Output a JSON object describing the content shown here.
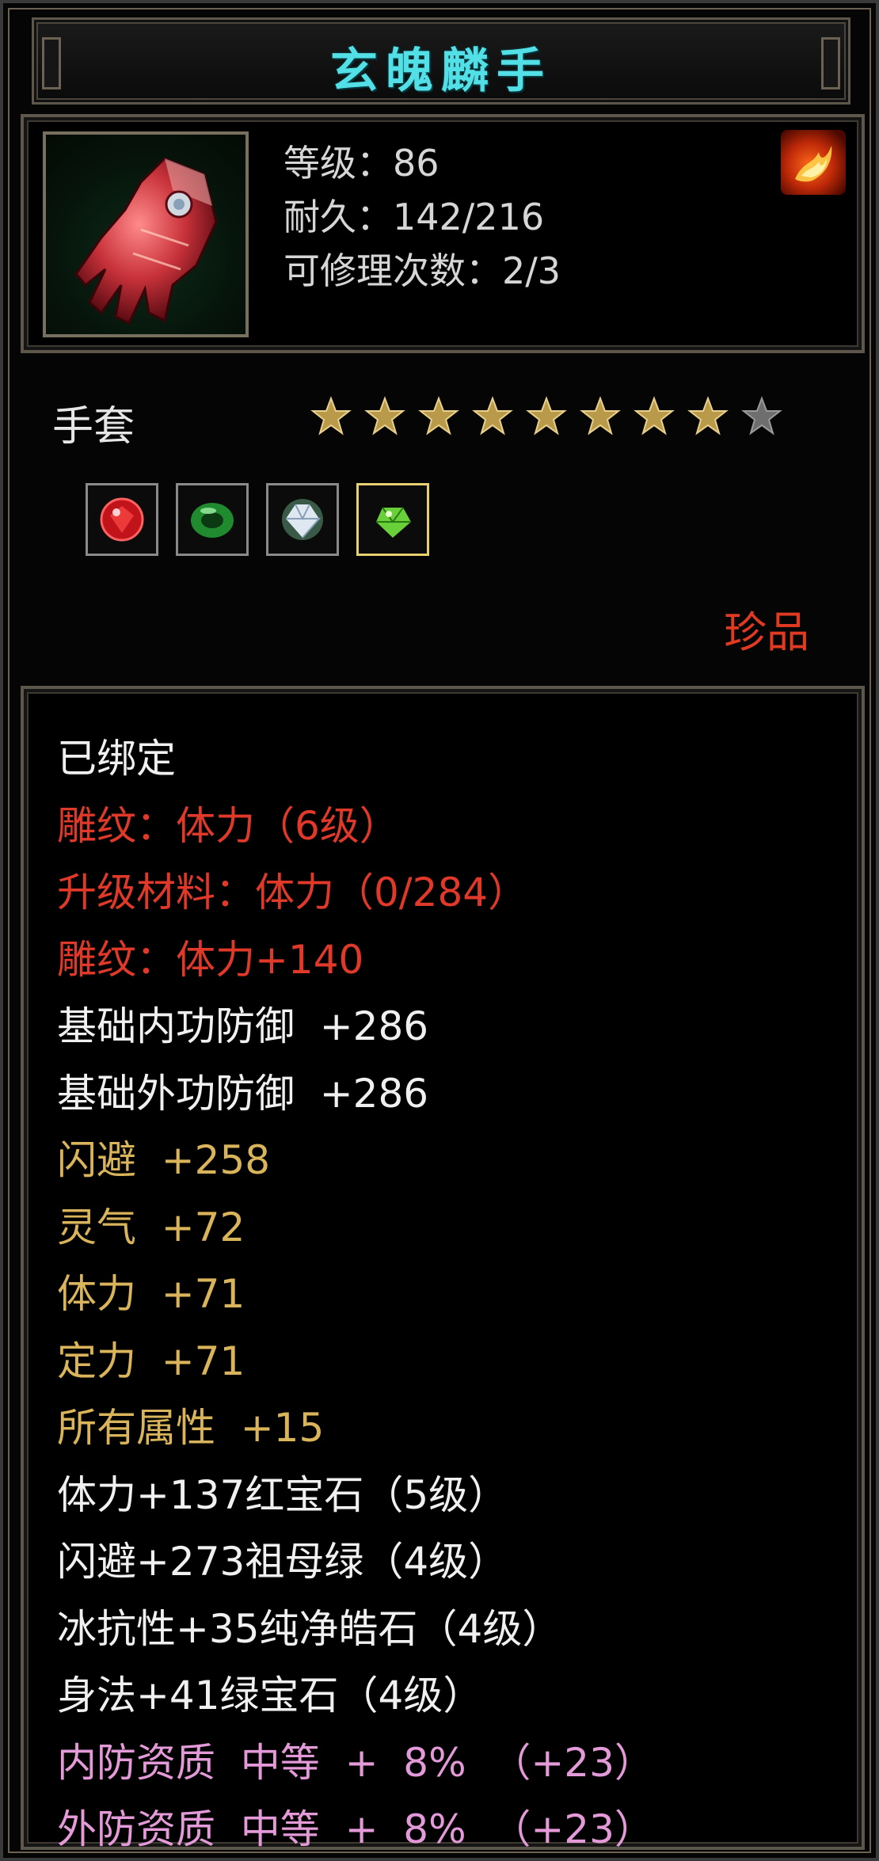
{
  "title": "玄魄麟手",
  "item": {
    "level": "等级：86",
    "durability": "耐久：142/216",
    "repair": "可修理次数：2/3",
    "icon": "gauntlet-icon",
    "badge_icon": "fire-badge-icon"
  },
  "type_label": "手套",
  "stars": {
    "filled": 8,
    "total": 9
  },
  "gems": [
    "ruby-gem-icon",
    "emerald-gem-icon",
    "diamond-gem-icon",
    "peridot-gem-icon"
  ],
  "rarity": "珍品",
  "attributes": [
    {
      "text": "已绑定",
      "color": "white"
    },
    {
      "text": "雕纹：体力（6级）",
      "color": "red"
    },
    {
      "text": "升级材料：体力（0/284）",
      "color": "red"
    },
    {
      "text": "雕纹：体力+140",
      "color": "red"
    },
    {
      "text": "基础内功防御  +286",
      "color": "white"
    },
    {
      "text": "基础外功防御  +286",
      "color": "white"
    },
    {
      "text": "闪避  +258",
      "color": "gold"
    },
    {
      "text": "灵气  +72",
      "color": "gold"
    },
    {
      "text": "体力  +71",
      "color": "gold"
    },
    {
      "text": "定力  +71",
      "color": "gold"
    },
    {
      "text": "所有属性  +15",
      "color": "gold"
    },
    {
      "text": "体力+137红宝石（5级）",
      "color": "white"
    },
    {
      "text": "闪避+273祖母绿（4级）",
      "color": "white"
    },
    {
      "text": "冰抗性+35纯净皓石（4级）",
      "color": "white"
    },
    {
      "text": "身法+41绿宝石（4级）",
      "color": "white"
    },
    {
      "text": "内防资质  中等  +  8%  （+23）",
      "color": "pink"
    },
    {
      "text": "外防资质  中等  +  8%  （+23）",
      "color": "pink"
    }
  ],
  "colors": {
    "white": "#f0f0f0",
    "red": "#e0392a",
    "gold": "#d9b45a",
    "pink": "#e49ad8",
    "title": "#52e0e6"
  }
}
